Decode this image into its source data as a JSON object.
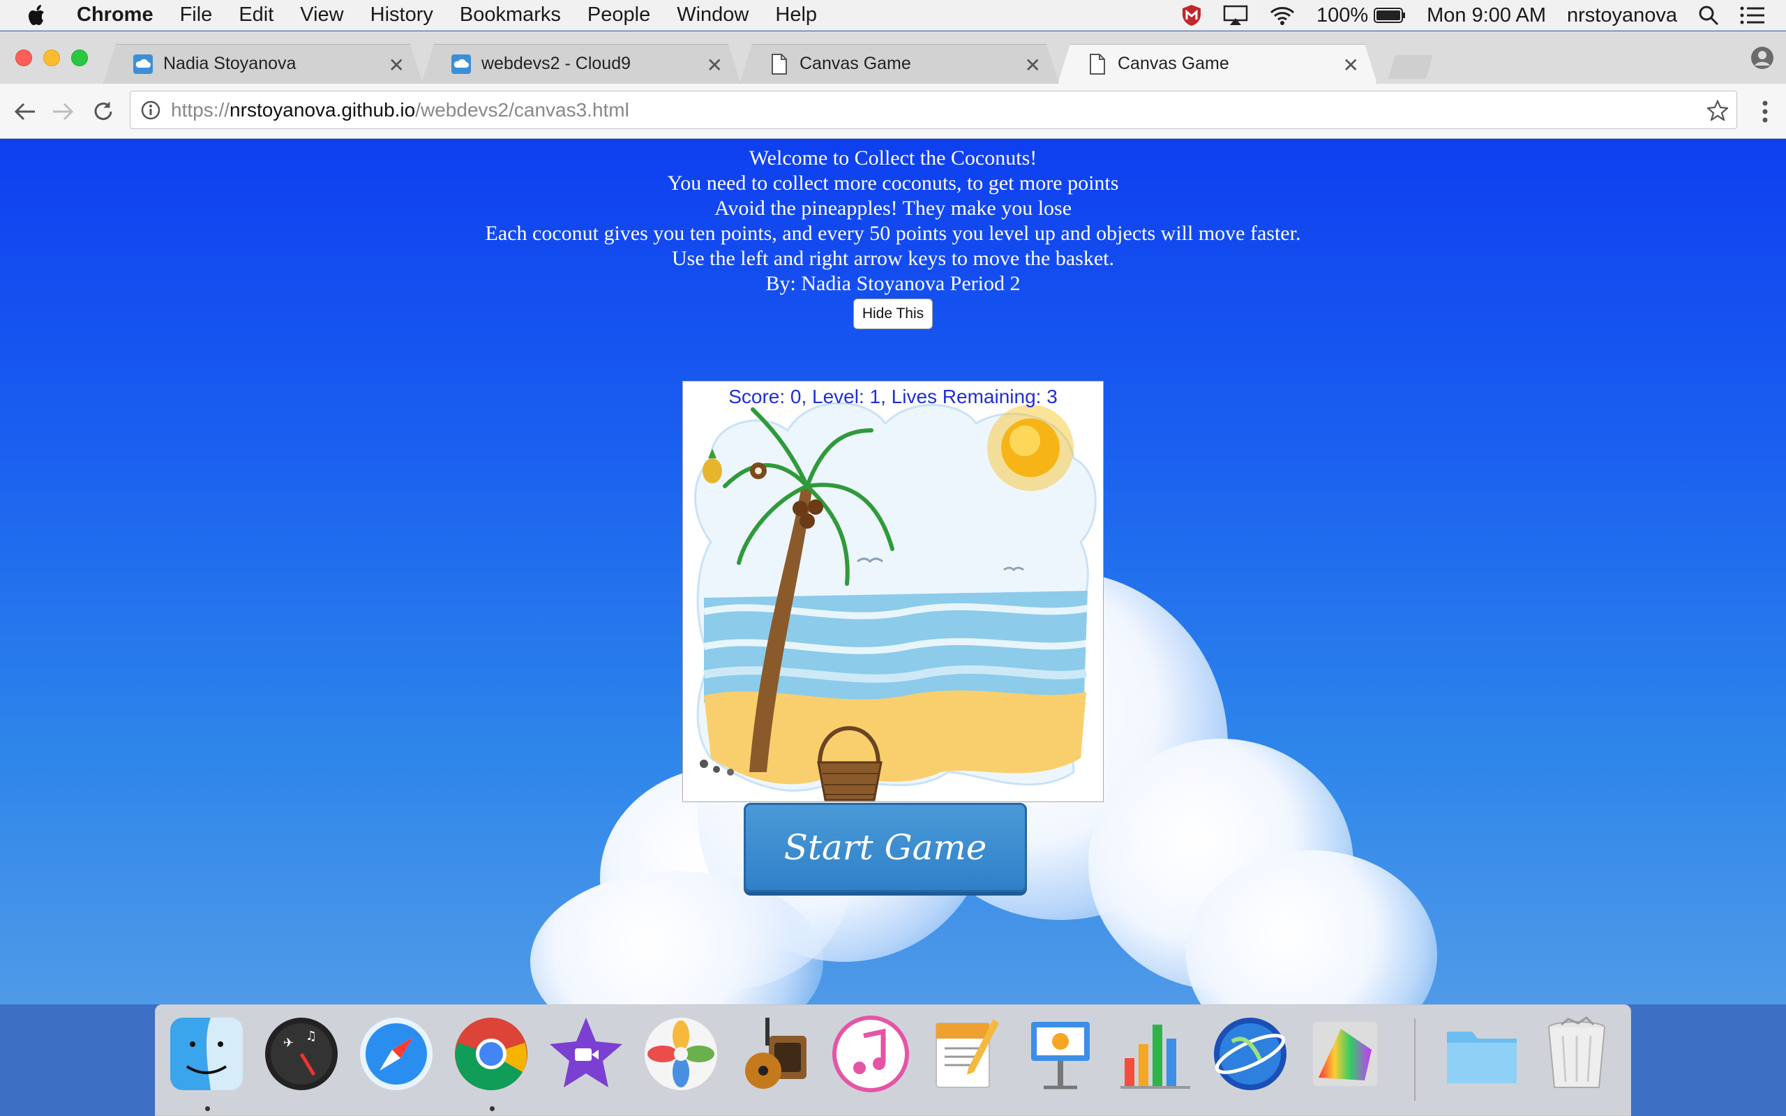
{
  "menubar": {
    "app_name": "Chrome",
    "items": [
      "File",
      "Edit",
      "View",
      "History",
      "Bookmarks",
      "People",
      "Window",
      "Help"
    ],
    "battery": "100%",
    "clock": "Mon 9:00 AM",
    "user": "nrstoyanova"
  },
  "tabs": [
    {
      "title": "Nadia Stoyanova",
      "icon": "cloud9-icon",
      "active": false
    },
    {
      "title": "webdevs2 - Cloud9",
      "icon": "cloud9-icon",
      "active": false
    },
    {
      "title": "Canvas Game",
      "icon": "document-icon",
      "active": false
    },
    {
      "title": "Canvas Game",
      "icon": "document-icon",
      "active": true
    }
  ],
  "toolbar": {
    "url_scheme": "https://",
    "url_host": "nrstoyanova.github.io",
    "url_path": "/webdevs2/canvas3.html"
  },
  "page": {
    "intro_lines": [
      "Welcome to Collect the Coconuts!",
      "You need to collect more coconuts, to get more points",
      "Avoid the pineapples! They make you lose",
      "Each coconut gives you ten points, and every 50 points you level up and objects will move faster.",
      "Use the left and right arrow keys to move the basket.",
      "By: Nadia Stoyanova Period 2"
    ],
    "hide_button": "Hide This",
    "score_text": "Score: 0, Level: 1, Lives Remaining: 3",
    "start_button": "Start Game"
  },
  "dock": [
    "finder-icon",
    "dashboard-icon",
    "safari-icon",
    "chrome-icon",
    "imovie-icon",
    "photos-icon",
    "garageband-icon",
    "itunes-icon",
    "pages-icon",
    "keynote-icon",
    "numbers-icon",
    "google-earth-icon",
    "grapher-icon",
    "folder-icon",
    "trash-icon"
  ],
  "colors": {
    "page_top": "#0e3ff0",
    "page_bottom": "#4f9ae8",
    "score_text": "#1f2fd8",
    "start_button": "#3a8bd0"
  }
}
